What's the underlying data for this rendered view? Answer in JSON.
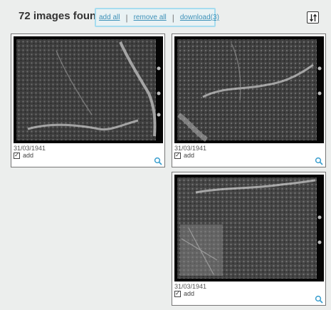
{
  "header": {
    "results_count": "72 images found",
    "actions": {
      "add_all": "add all",
      "remove_all": "remove all",
      "download": "download(3)"
    },
    "separator": "|",
    "sort_icon": "sort-order-icon"
  },
  "colors": {
    "link": "#3e91b8",
    "highlight_border": "#a6dcef",
    "zoom_icon": "#3b9fcf"
  },
  "results": [
    {
      "date": "31/03/1941",
      "add_label": "add",
      "checked": true,
      "image": "aerial-photo"
    },
    {
      "date": "31/03/1941",
      "add_label": "add",
      "checked": true,
      "image": "aerial-photo"
    },
    {
      "date": "31/03/1941",
      "add_label": "add",
      "checked": true,
      "image": "aerial-photo"
    }
  ]
}
